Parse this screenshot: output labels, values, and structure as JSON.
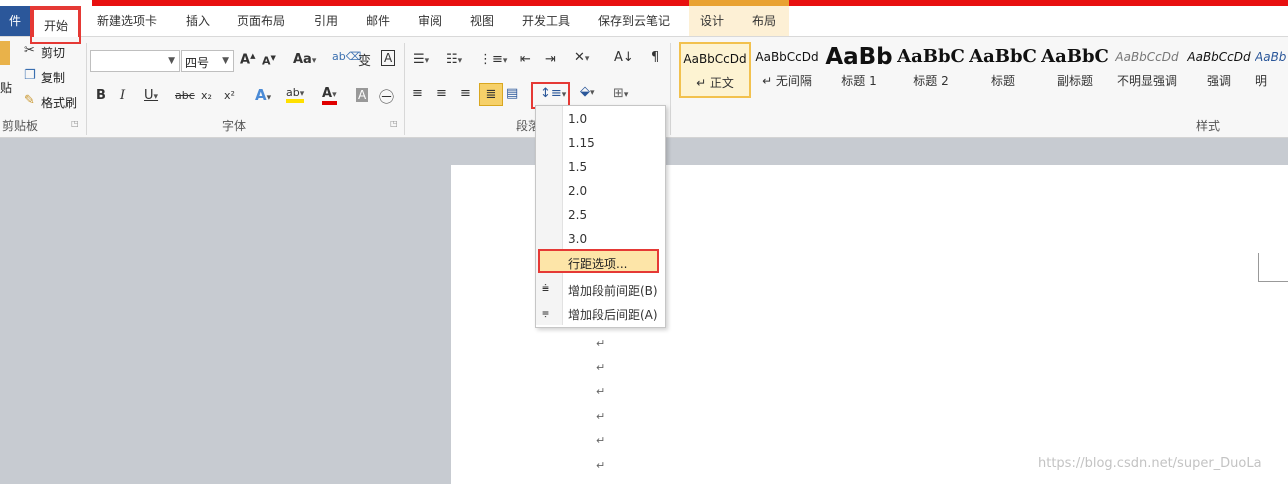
{
  "tabs": {
    "file": "件",
    "home": "开始",
    "new_tab": "新建选项卡",
    "insert": "插入",
    "page_layout": "页面布局",
    "references": "引用",
    "mailings": "邮件",
    "review": "审阅",
    "view": "视图",
    "developer": "开发工具",
    "save_cloud": "保存到云笔记",
    "design": "设计",
    "layout": "布局"
  },
  "clipboard": {
    "paste": "贴",
    "cut": "剪切",
    "copy": "复制",
    "format_painter": "格式刷",
    "group_label": "剪贴板"
  },
  "font": {
    "font_name": "",
    "font_size": "四号",
    "group_label": "字体"
  },
  "paragraph": {
    "group_label": "段落"
  },
  "styles": {
    "items": [
      {
        "preview": "AaBbCcDd",
        "name": "↵ 正文"
      },
      {
        "preview": "AaBbCcDd",
        "name": "↵ 无间隔"
      },
      {
        "preview": "AaBb",
        "name": "标题 1"
      },
      {
        "preview": "AaBbC",
        "name": "标题 2"
      },
      {
        "preview": "AaBbC",
        "name": "标题"
      },
      {
        "preview": "AaBbC",
        "name": "副标题"
      },
      {
        "preview": "AaBbCcDd",
        "name": "不明显强调"
      },
      {
        "preview": "AaBbCcDd",
        "name": "强调"
      },
      {
        "preview": "AaBb",
        "name": "明"
      }
    ],
    "group_label": "样式"
  },
  "line_spacing_menu": {
    "values": [
      "1.0",
      "1.15",
      "1.5",
      "2.0",
      "2.5",
      "3.0"
    ],
    "options": "行距选项...",
    "add_before": "增加段前间距(B)",
    "add_after": "增加段后间距(A)"
  },
  "document": {
    "paragraph_mark": "↵"
  },
  "watermark": "https://blog.csdn.net/super_DuoLa",
  "colors": {
    "accent_red": "#e53935",
    "file_tab": "#2b579a",
    "highlight": "#fde5a8"
  }
}
